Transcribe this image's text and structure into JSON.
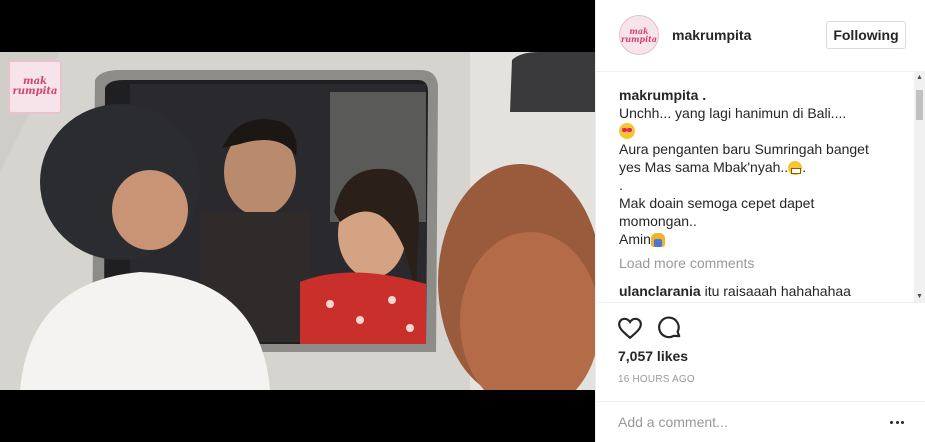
{
  "post": {
    "username": "makrumpita",
    "follow_label": "Following",
    "watermark_text": [
      "mak",
      "rumpita"
    ],
    "avatar_text": [
      "mak",
      "rumpita"
    ]
  },
  "caption": {
    "username": "makrumpita .",
    "lines": [
      "Unchh... yang lagi hanimun di Bali....",
      "Aura penganten baru Sumringah banget",
      "yes Mas sama Mbak'nyah..",
      ".",
      "Mak doain semoga cepet dapet",
      "momongan..",
      "Amin"
    ],
    "emojis": [
      "heart-eyes-emoji",
      "grinning-emoji",
      "praying-emoji"
    ]
  },
  "load_more": "Load more comments",
  "comments": [
    {
      "username": "ulanclarania",
      "text": "itu raisaaah hahahahaa"
    }
  ],
  "likes": "7,057 likes",
  "timestamp": "16 HOURS AGO",
  "add_comment_placeholder": "Add a comment...",
  "icons": {
    "like": "heart-icon",
    "comment": "comment-bubble-icon",
    "more": "more-options-icon"
  },
  "colors": {
    "border": "#efefef",
    "muted": "#999999",
    "text": "#262626",
    "watermark": "#d2436f"
  }
}
